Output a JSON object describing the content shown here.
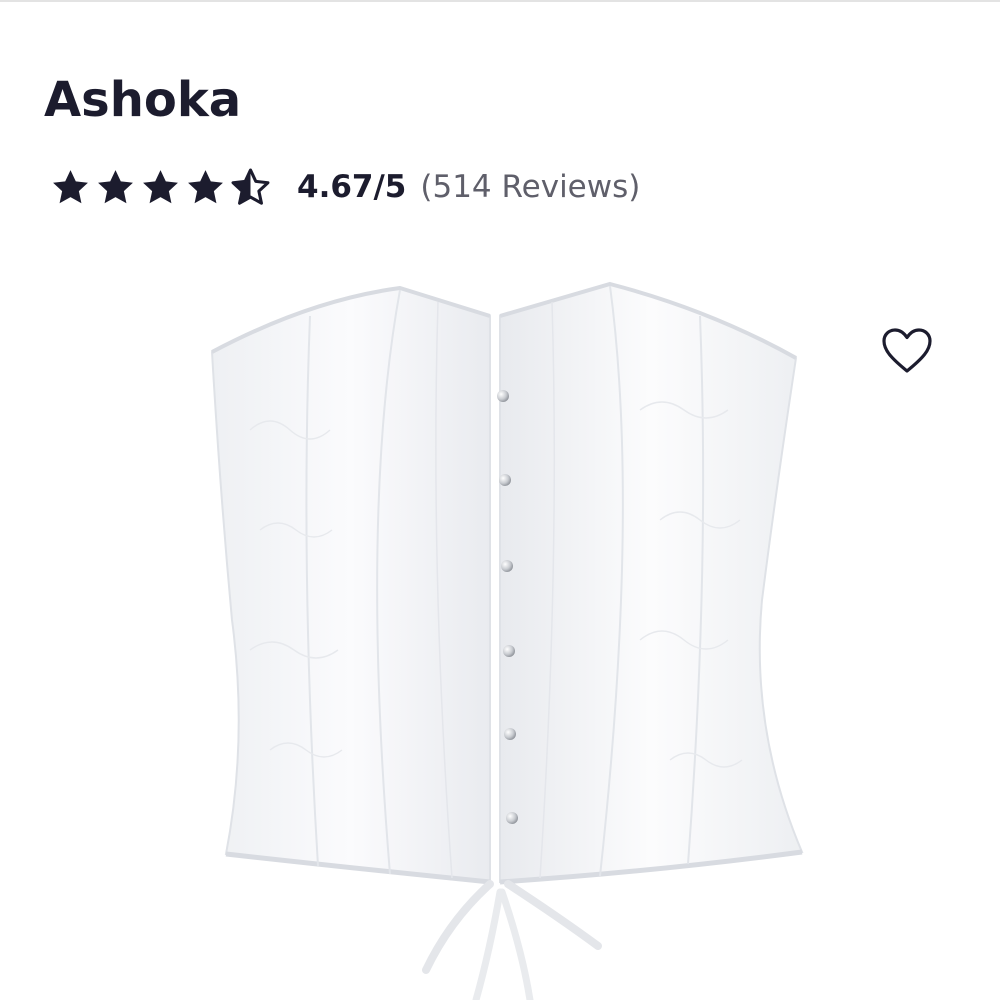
{
  "product": {
    "title": "Ashoka",
    "rating": {
      "value_label": "4.67/5",
      "reviews_label": "(514 Reviews)",
      "stars_filled": 4.67,
      "stars_max": 5,
      "star_color": "#1c1c2e"
    },
    "image": {
      "subject": "white-lace-corset",
      "background": "#ffffff"
    },
    "wishlist": {
      "icon": "heart-outline-icon",
      "color": "#1c1c2e"
    }
  }
}
